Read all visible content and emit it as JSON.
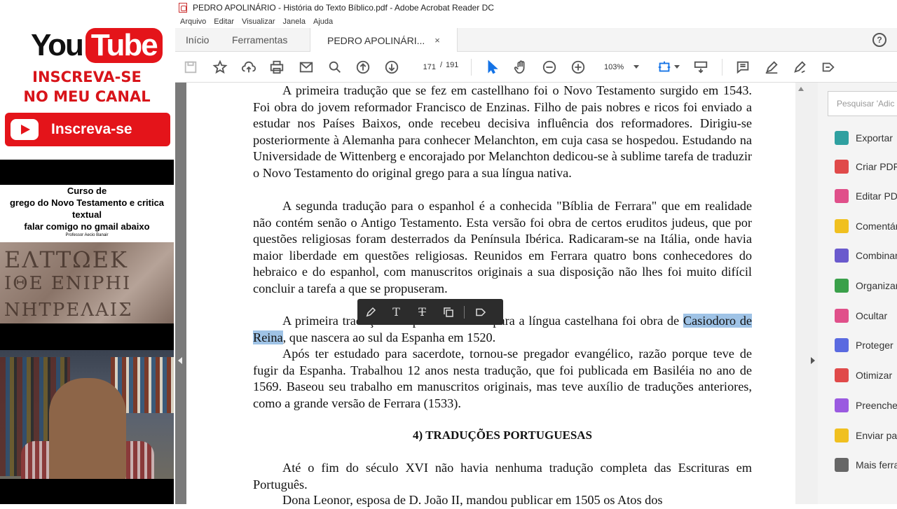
{
  "left_overlay": {
    "youtube_you": "You",
    "youtube_tube": "Tube",
    "subscribe_line1": "INSCREVA-SE",
    "subscribe_line2": "NO MEU CANAL",
    "subscribe_button": "Inscreva-se",
    "course_line1": "Curso de",
    "course_line2": "grego do Novo Testamento e critica",
    "course_line3": "textual",
    "course_line4": "falar comigo no gmail abaixo",
    "course_small": "Professor Aecio Banair",
    "stone_line1": "ЕΛΤΤΩΕΚ",
    "stone_line2": "ΙΘΕ ΕΝΙΡΗΙ",
    "stone_line3": "ΝΗΤΡΕΛΑΙΣ"
  },
  "window": {
    "title": "PEDRO APOLINÁRIO - História do Texto Bíblico.pdf - Adobe Acrobat Reader DC"
  },
  "menu": [
    "Arquivo",
    "Editar",
    "Visualizar",
    "Janela",
    "Ajuda"
  ],
  "tabs": {
    "home": "Início",
    "tools": "Ferramentas",
    "document": "PEDRO APOLINÁRI...",
    "close": "×",
    "help": "?"
  },
  "toolbar": {
    "current_page": "171",
    "separator": "/",
    "total_pages": "191",
    "zoom": "103%"
  },
  "document": {
    "para1": "A primeira tradução que se fez em castellhano foi o Novo Testamento surgido em 1543. Foi obra do jovem reformador Francisco de Enzinas. Filho de pais nobres e ricos foi enviado a estudar nos Países Baixos, onde recebeu decisiva influência dos reformadores. Dirigiu-se posteriormente à Alemanha para conhecer Melanchton, em cuja casa se hospedou. Estudando na Universidade de Wittenberg e encorajado por Melanchton dedicou-se à sublime tarefa de traduzir o Novo Testamento do original grego para a sua língua nativa.",
    "para2": "A segunda tradução para o espanhol é a conhecida \"Bíblia de Ferrara\" que em realidade não contém senão o Antigo Testamento. Esta versão foi obra de certos eruditos judeus, que por questões religiosas foram desterrados da Península Ibérica. Radicaram-se na Itália, onde havia maior liberdade em questões religiosas. Reunidos em Ferrara quatro bons conhecedores do hebraico e do espanhol, com manuscritos originais a sua disposição não lhes foi muito difícil concluir a tarefa a que se propuseram.",
    "para3_start": "A primeira tradução completa da Bíblia para a língua castelhana foi obra de",
    "para3_highlight": "Casiodoro de Reina",
    "para3_end": ", que nascera ao sul da Espanha em 1520.",
    "para4": "Após ter estudado para sacerdote, tornou-se pregador evangélico, razão porque teve de fugir da Espanha. Trabalhou 12 anos nesta tradução, que foi publicada em Basiléia no ano de 1569. Baseou seu trabalho em manuscritos originais, mas teve auxílio de traduções anteriores, como a grande versão de Ferrara (1533).",
    "heading": "4) TRADUÇÕES PORTUGUESAS",
    "para5": "Até o fim do século XVI não havia nenhuma tradução completa das Escrituras em Português.",
    "para6": "Dona Leonor, esposa de D. João II, mandou publicar em 1505 os Atos dos"
  },
  "floating_toolbar": {
    "text_tool_1": "T",
    "text_tool_2": "T"
  },
  "right_panel": {
    "search_placeholder": "Pesquisar 'Adic",
    "items": [
      {
        "label": "Exportar",
        "color": "#2fa0a0"
      },
      {
        "label": "Criar PDF",
        "color": "#e04a4a"
      },
      {
        "label": "Editar PDF",
        "color": "#e0508a"
      },
      {
        "label": "Comentário",
        "color": "#f0c020"
      },
      {
        "label": "Combinar",
        "color": "#6a5acd"
      },
      {
        "label": "Organizar",
        "color": "#3aa04a"
      },
      {
        "label": "Ocultar",
        "color": "#e0508a"
      },
      {
        "label": "Proteger",
        "color": "#5a6ae0"
      },
      {
        "label": "Otimizar",
        "color": "#e04a4a"
      },
      {
        "label": "Preencher",
        "color": "#9a5ae0"
      },
      {
        "label": "Enviar para",
        "color": "#f0c020"
      },
      {
        "label": "Mais ferramentas",
        "color": "#666666"
      }
    ]
  }
}
